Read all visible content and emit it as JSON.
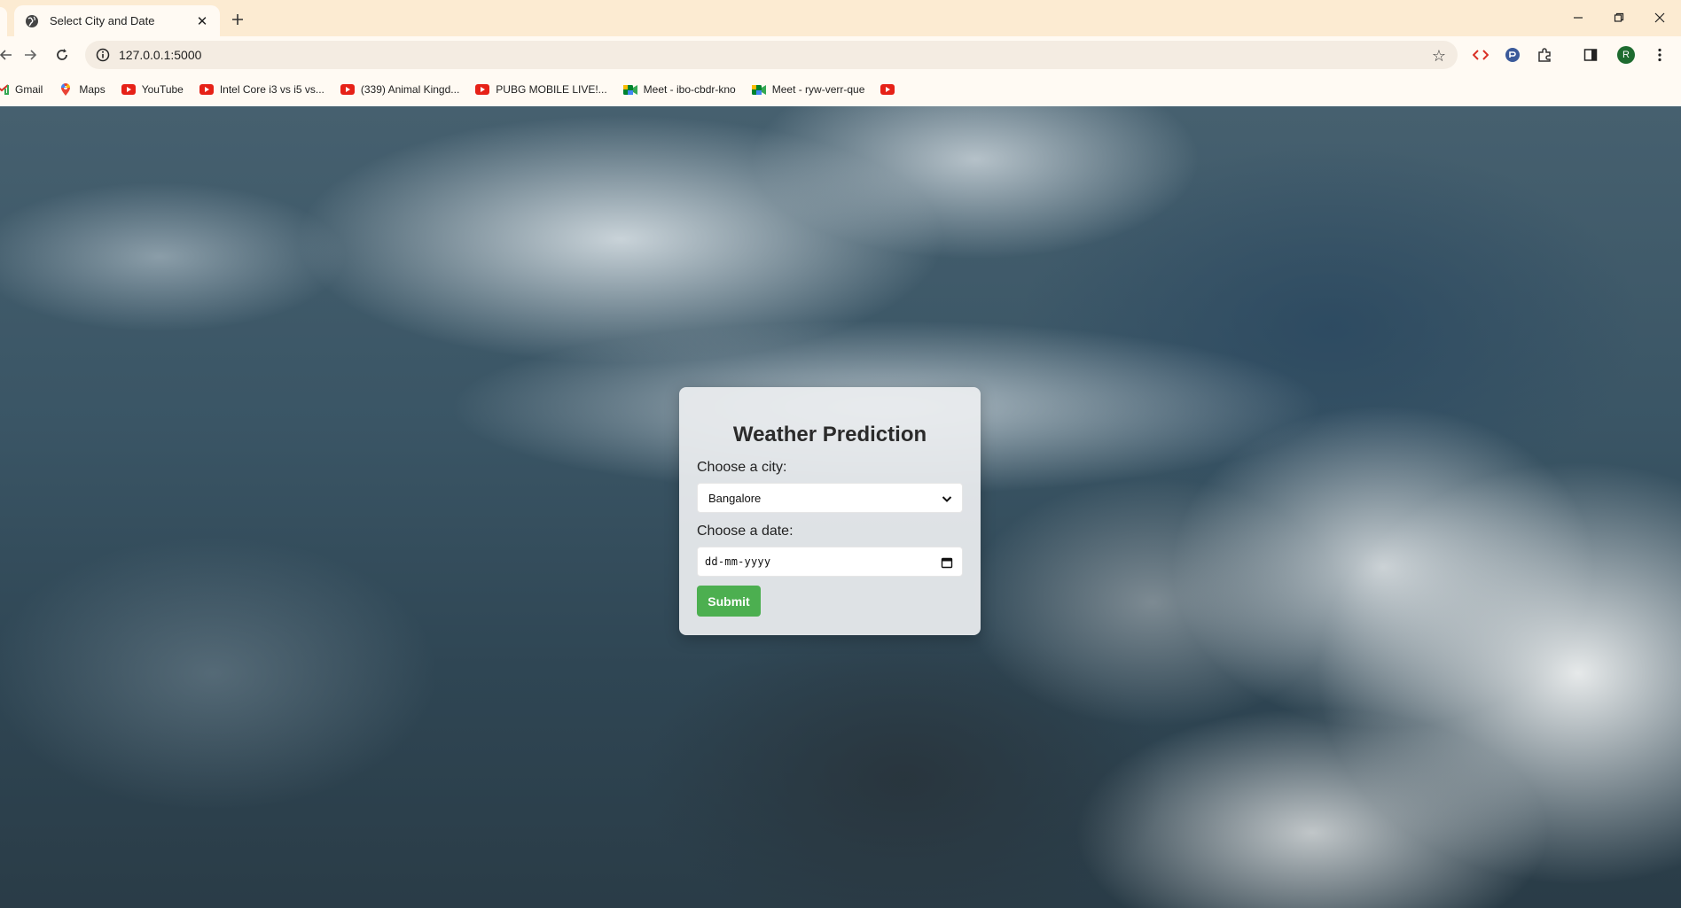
{
  "browser": {
    "tab": {
      "title": "Select City and Date",
      "favicon": "globe-icon"
    },
    "address": {
      "url": "127.0.0.1:5000"
    },
    "bookmarks": [
      {
        "label": "Gmail",
        "icon": "gmail-icon"
      },
      {
        "label": "Maps",
        "icon": "maps-icon"
      },
      {
        "label": "YouTube",
        "icon": "youtube-icon"
      },
      {
        "label": "Intel Core i3 vs i5 vs...",
        "icon": "youtube-icon"
      },
      {
        "label": "(339) Animal Kingd...",
        "icon": "youtube-icon"
      },
      {
        "label": "PUBG MOBILE LIVE!...",
        "icon": "youtube-icon"
      },
      {
        "label": "Meet - ibo-cbdr-kno",
        "icon": "meet-icon"
      },
      {
        "label": "Meet - ryw-verr-que",
        "icon": "meet-icon"
      },
      {
        "label": "",
        "icon": "youtube-icon"
      }
    ],
    "profile_initial": "R",
    "colors": {
      "frame": "#fcebd2",
      "toolbar": "#fffaf3",
      "profile": "#1e6b2f"
    }
  },
  "page": {
    "title": "Weather Prediction",
    "city_label": "Choose a city:",
    "city_value": "Bangalore",
    "date_label": "Choose a date:",
    "date_placeholder": "dd-mm-yyyy",
    "submit_label": "Submit",
    "colors": {
      "submit": "#4caf50",
      "card": "#eceef0"
    }
  }
}
